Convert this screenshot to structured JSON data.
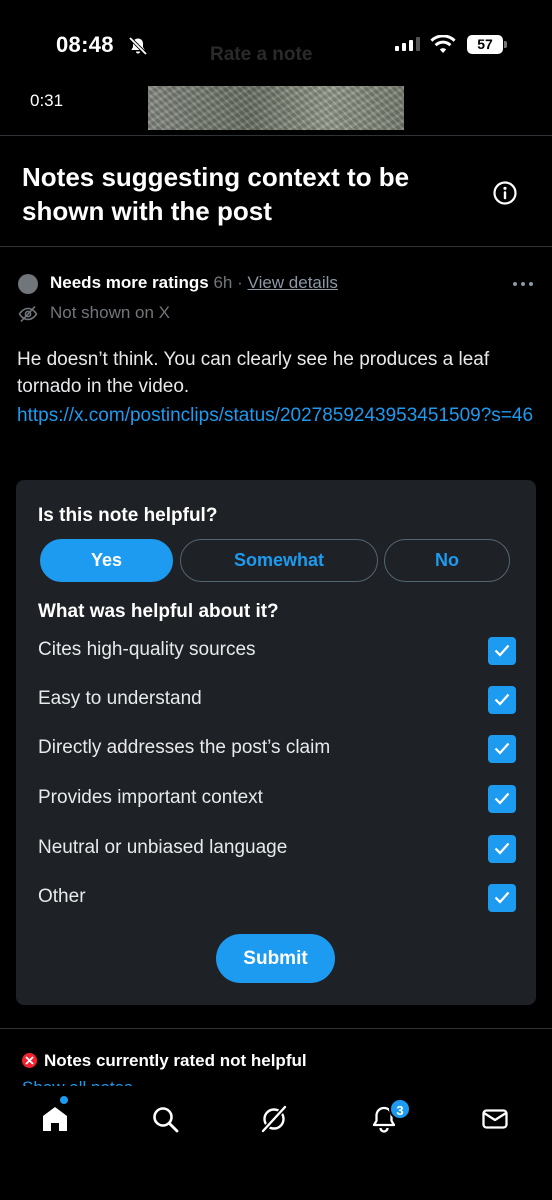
{
  "status_bar": {
    "time": "08:48",
    "battery": "57",
    "ghost_title": "Rate a note"
  },
  "video": {
    "timestamp": "0:31"
  },
  "header": {
    "title": "Notes suggesting context to be shown with the post"
  },
  "note": {
    "status": "Needs more ratings",
    "age": "6h",
    "separator": "·",
    "view_details": "View details",
    "visibility": "Not shown on X",
    "text": "He doesn’t think. You can clearly see he produces a leaf tornado in the video.",
    "link": "https://x.com/postinclips/status/2027859243953451509?s=46"
  },
  "rating": {
    "question": "Is this note helpful?",
    "options": [
      "Yes",
      "Somewhat",
      "No"
    ],
    "selected": "Yes",
    "subquestion": "What was helpful about it?",
    "reasons": [
      {
        "label": "Cites high-quality sources",
        "checked": true
      },
      {
        "label": "Easy to understand",
        "checked": true
      },
      {
        "label": "Directly addresses the post’s claim",
        "checked": true
      },
      {
        "label": "Provides important context",
        "checked": true
      },
      {
        "label": "Neutral or unbiased language",
        "checked": true
      },
      {
        "label": "Other",
        "checked": true
      }
    ],
    "submit_label": "Submit"
  },
  "not_helpful": {
    "label": "Notes currently rated not helpful",
    "show_all": "Show all notes"
  },
  "bottom_nav": {
    "items": [
      "home-icon",
      "search-icon",
      "grok-icon",
      "notifications-icon",
      "messages-icon"
    ],
    "notification_count": "3"
  },
  "colors": {
    "accent": "#1d9bf0",
    "background": "#000000",
    "card": "#1e2125",
    "error": "#f4212e"
  }
}
